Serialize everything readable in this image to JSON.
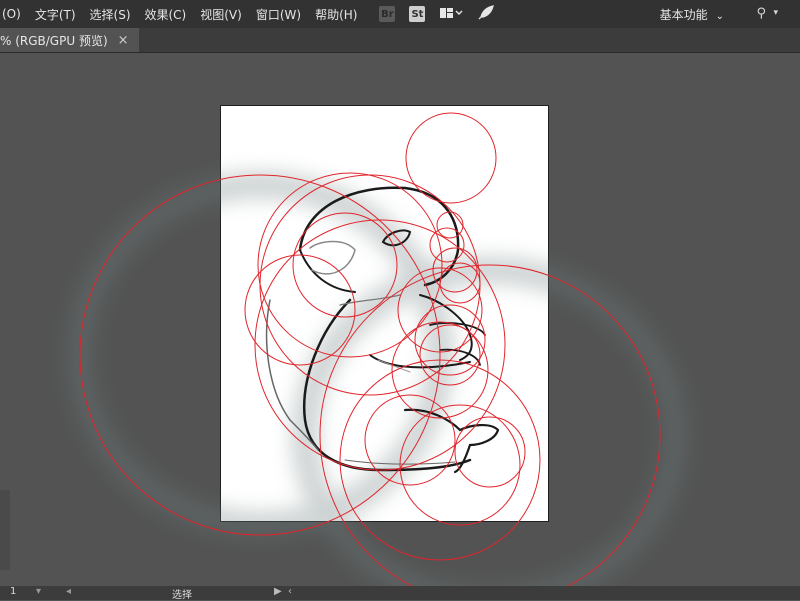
{
  "menubar": {
    "items": [
      "(O)",
      "文字(T)",
      "选择(S)",
      "效果(C)",
      "视图(V)",
      "窗口(W)",
      "帮助(H)"
    ],
    "tools": [
      {
        "icon": "bridge-icon",
        "label": "Br"
      },
      {
        "icon": "stock-icon",
        "label": "St"
      },
      {
        "icon": "workspace-switcher-icon",
        "label": ""
      },
      {
        "icon": "feather-icon",
        "label": ""
      }
    ],
    "workspace_label": "基本功能",
    "search_icon": "search-icon"
  },
  "tab": {
    "title": "% (RGB/GPU 预览)",
    "close": "×"
  },
  "statusbar": {
    "zoom": "1",
    "tool": "选择"
  },
  "colors": {
    "menubar": "#323232",
    "pasteboard": "#535353",
    "artboard": "#ffffff",
    "guide_circles": "#e0252c",
    "sketch": "#1a1a1a"
  }
}
